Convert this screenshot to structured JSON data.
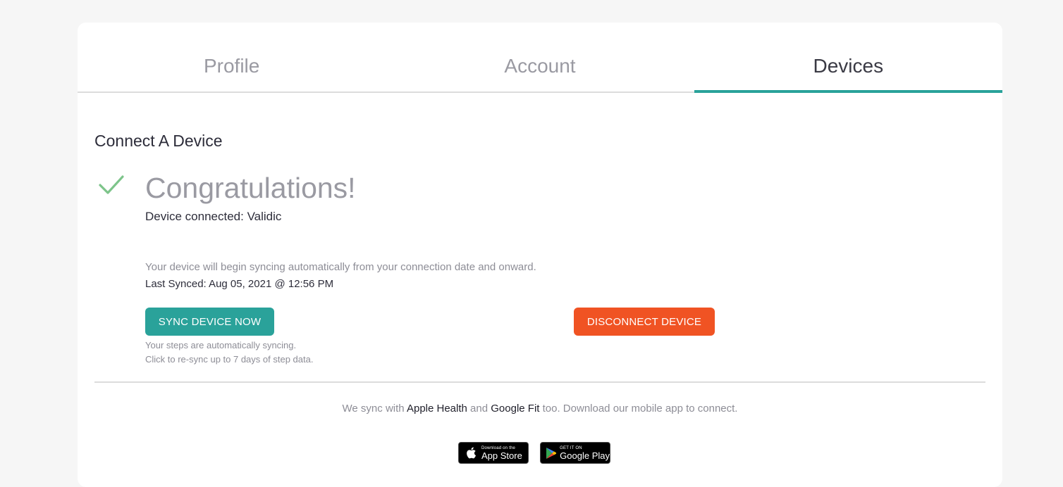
{
  "tabs": [
    {
      "label": "Profile",
      "active": false
    },
    {
      "label": "Account",
      "active": false
    },
    {
      "label": "Devices",
      "active": true
    }
  ],
  "section": {
    "title": "Connect A Device"
  },
  "status": {
    "icon": "checkmark-icon",
    "heading": "Congratulations!",
    "device_connected": "Device connected: Validic",
    "sync_info": "Your device will begin syncing automatically from your connection date and onward.",
    "last_synced": "Last Synced: Aug 05, 2021 @ 12:56 PM"
  },
  "actions": {
    "sync_label": "SYNC DEVICE NOW",
    "disconnect_label": "DISCONNECT DEVICE",
    "help_line1": "Your steps are automatically syncing.",
    "help_line2": "Click to re-sync up to 7 days of step data."
  },
  "mobile": {
    "prefix": "We sync with",
    "apple_health": "Apple Health",
    "and": "and",
    "google_fit": "Google Fit",
    "suffix": "too. Download our mobile app to connect.",
    "app_store_small": "Download on the",
    "app_store_big": "App Store",
    "google_play_small": "GET IT ON",
    "google_play_big": "Google Play"
  },
  "colors": {
    "accent": "#2aa29a",
    "danger": "#f05323",
    "success": "#7dc48a"
  }
}
